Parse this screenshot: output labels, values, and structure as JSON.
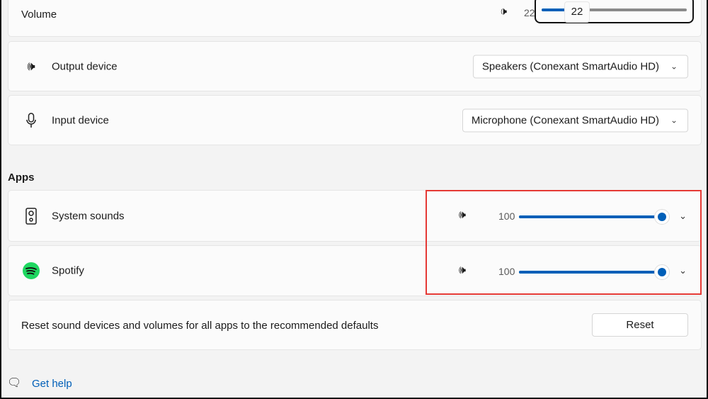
{
  "volume": {
    "label": "Volume",
    "value": "22",
    "tooltip": "22",
    "percent": 22
  },
  "output": {
    "label": "Output device",
    "selected": "Speakers (Conexant SmartAudio HD)"
  },
  "input": {
    "label": "Input device",
    "selected": "Microphone (Conexant SmartAudio HD)"
  },
  "apps_heading": "Apps",
  "apps": [
    {
      "name": "System sounds",
      "value": "100",
      "percent": 100
    },
    {
      "name": "Spotify",
      "value": "100",
      "percent": 100
    }
  ],
  "reset": {
    "text": "Reset sound devices and volumes for all apps to the recommended defaults",
    "button": "Reset"
  },
  "help": {
    "label": "Get help"
  },
  "colors": {
    "accent": "#005fb8",
    "highlight": "#e53935",
    "spotify": "#1ed760"
  }
}
